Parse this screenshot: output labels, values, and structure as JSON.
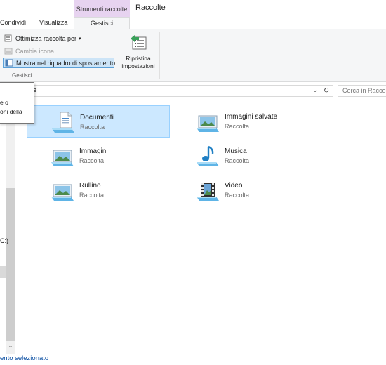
{
  "titlebar": {
    "tabs": [
      {
        "label": "Condividi"
      },
      {
        "label": "Visualizza"
      }
    ],
    "context_header": "Strumenti raccolte",
    "context_tab": "Gestisci",
    "window_title": "Raccolte",
    "context_color": "#e7d3f0"
  },
  "ribbon": {
    "optimize_label": "Ottimizza raccolta per",
    "change_icon_label": "Cambia icona",
    "show_nav_label": "Mostra nel riquadro di spostamento",
    "group_label": "Gestisci",
    "restore_line1": "Ripristina",
    "restore_line2": "impostazioni"
  },
  "address": {
    "path_fragment": "e",
    "search_placeholder": "Cerca in Raccolte"
  },
  "tooltip": {
    "line1": "e o",
    "line2": "oni della"
  },
  "nav": {
    "drive_fragment": "C:)"
  },
  "items": [
    {
      "name": "Documenti",
      "type": "Raccolta",
      "icon": "documents-library-icon",
      "selected": true
    },
    {
      "name": "Immagini salvate",
      "type": "Raccolta",
      "icon": "saved-pictures-library-icon",
      "selected": false
    },
    {
      "name": "Immagini",
      "type": "Raccolta",
      "icon": "pictures-library-icon",
      "selected": false
    },
    {
      "name": "Musica",
      "type": "Raccolta",
      "icon": "music-library-icon",
      "selected": false
    },
    {
      "name": "Rullino",
      "type": "Raccolta",
      "icon": "camera-roll-library-icon",
      "selected": false
    },
    {
      "name": "Video",
      "type": "Raccolta",
      "icon": "videos-library-icon",
      "selected": false
    }
  ],
  "status": {
    "text": "ento selezionato"
  },
  "colors": {
    "selection_bg": "#cce8ff",
    "selection_border": "#99d1ff",
    "status_text": "#0b4fa3"
  }
}
